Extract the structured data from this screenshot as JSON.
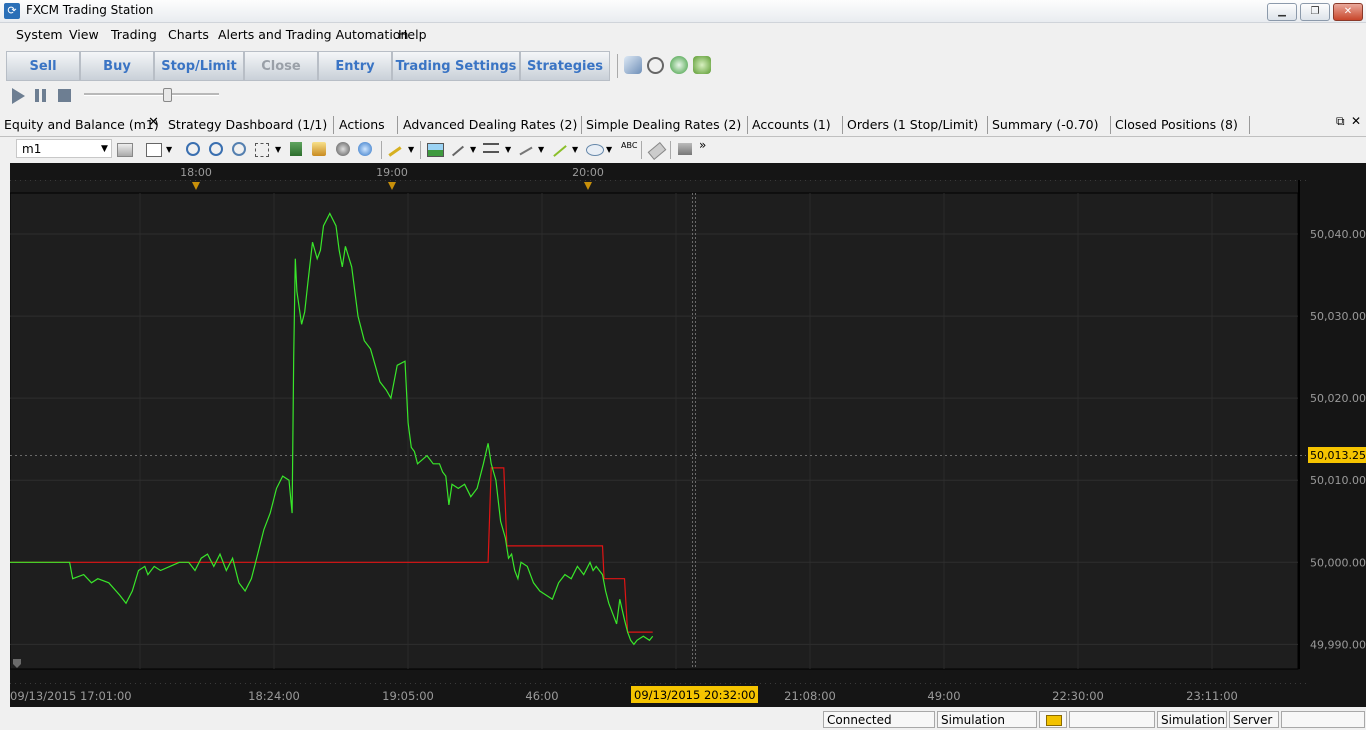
{
  "window": {
    "title": "FXCM Trading Station",
    "icon": "fxcm-logo-icon"
  },
  "menu": [
    "System",
    "View",
    "Trading",
    "Charts",
    "Alerts and Trading Automation",
    "Help"
  ],
  "toolbar": {
    "buttons": [
      "Sell",
      "Buy",
      "Stop/Limit",
      "Close",
      "Entry",
      "Trading Settings",
      "Strategies"
    ],
    "disabled": [
      "Close"
    ]
  },
  "tabs": [
    "Equity and Balance (m1)",
    "Strategy Dashboard (1/1)",
    "Actions",
    "Advanced Dealing Rates (2)",
    "Simple Dealing Rates (2)",
    "Accounts (1)",
    "Orders (1 Stop/Limit)",
    "Summary (-0.70)",
    "Closed Positions (8)"
  ],
  "chart_toolbar": {
    "timeframe": "m1"
  },
  "chart_data": {
    "type": "line",
    "top_axis_labels": [
      "18:00",
      "19:00",
      "20:00"
    ],
    "bottom_axis_labels": [
      "09/13/2015 17:01:00",
      "18:24:00",
      "19:05:00",
      "46:00",
      "21:08:00",
      "49:00",
      "22:30:00",
      "23:11:00"
    ],
    "cursor_time_label": "09/13/2015 20:32:00",
    "y_labels": [
      "50,040.00",
      "50,030.00",
      "50,020.00",
      "50,010.00",
      "50,000.00",
      "49,990.00"
    ],
    "ylim": [
      49987,
      50045
    ],
    "current_value_label": "50,013.25",
    "current_value": 50013.25,
    "colors": {
      "equity": "#39e62a",
      "balance": "#e01414",
      "highlight": "#f5c400",
      "background": "#1e1e1e"
    },
    "series": [
      {
        "values": [
          [
            0,
            50000
          ],
          [
            38,
            50000
          ],
          [
            40,
            49998
          ],
          [
            47,
            49998.5
          ],
          [
            52,
            49997.5
          ],
          [
            56,
            49998
          ],
          [
            63,
            49997.5
          ],
          [
            70,
            49996
          ],
          [
            74,
            49995
          ],
          [
            78,
            49996.5
          ],
          [
            82,
            49999
          ],
          [
            86,
            49999.5
          ],
          [
            88,
            49998.5
          ],
          [
            92,
            49999.5
          ],
          [
            96,
            49999
          ],
          [
            102,
            49999.5
          ],
          [
            108,
            50000
          ],
          [
            114,
            50000
          ],
          [
            118,
            49999
          ],
          [
            122,
            50000.5
          ],
          [
            126,
            50001
          ],
          [
            130,
            49999.5
          ],
          [
            134,
            50001
          ],
          [
            138,
            49999
          ],
          [
            142,
            50000.5
          ],
          [
            146,
            49997.5
          ],
          [
            150,
            49996.5
          ],
          [
            154,
            49998
          ],
          [
            158,
            50001
          ],
          [
            162,
            50004
          ],
          [
            166,
            50006
          ],
          [
            170,
            50009
          ],
          [
            174,
            50010.5
          ],
          [
            178,
            50010
          ],
          [
            180,
            50006
          ],
          [
            181,
            50025
          ],
          [
            182,
            50037
          ],
          [
            183,
            50033
          ],
          [
            186,
            50029
          ],
          [
            188,
            50030.5
          ],
          [
            190,
            50034
          ],
          [
            193,
            50039
          ],
          [
            196,
            50037
          ],
          [
            198,
            50038
          ],
          [
            200,
            50041
          ],
          [
            204,
            50042.5
          ],
          [
            208,
            50041
          ],
          [
            210,
            50038
          ],
          [
            212,
            50036
          ],
          [
            214,
            50038.5
          ],
          [
            218,
            50036
          ],
          [
            222,
            50030
          ],
          [
            226,
            50027
          ],
          [
            230,
            50026
          ],
          [
            233,
            50024
          ],
          [
            236,
            50022
          ],
          [
            240,
            50021
          ],
          [
            243,
            50020
          ],
          [
            247,
            50024
          ],
          [
            252,
            50024.5
          ],
          [
            254,
            50017
          ],
          [
            256,
            50014
          ],
          [
            258,
            50013.5
          ],
          [
            260,
            50012
          ],
          [
            263,
            50012.5
          ],
          [
            266,
            50013
          ],
          [
            270,
            50012
          ],
          [
            274,
            50012
          ],
          [
            276,
            50011
          ],
          [
            278,
            50010.5
          ],
          [
            280,
            50007
          ],
          [
            282,
            50009.5
          ],
          [
            286,
            50009
          ],
          [
            290,
            50009.5
          ],
          [
            294,
            50008
          ],
          [
            298,
            50009
          ],
          [
            302,
            50012
          ],
          [
            305,
            50014.5
          ],
          [
            307,
            50012
          ],
          [
            310,
            50010
          ],
          [
            313,
            50005
          ],
          [
            316,
            50003
          ],
          [
            318,
            50000.5
          ],
          [
            320,
            50001
          ],
          [
            322,
            49999
          ],
          [
            324,
            49998
          ],
          [
            326,
            50000
          ],
          [
            330,
            49999.5
          ],
          [
            334,
            49997.5
          ],
          [
            338,
            49996.5
          ],
          [
            342,
            49996
          ],
          [
            346,
            49995.5
          ],
          [
            350,
            49997.5
          ],
          [
            354,
            49998.5
          ],
          [
            358,
            49998
          ],
          [
            362,
            49999.5
          ],
          [
            366,
            49998.5
          ],
          [
            370,
            50000
          ],
          [
            372,
            49999
          ],
          [
            374,
            49999.5
          ],
          [
            378,
            49998.5
          ],
          [
            380,
            49996.5
          ],
          [
            382,
            49995
          ],
          [
            385,
            49993.5
          ],
          [
            387,
            49992.5
          ],
          [
            389,
            49995.5
          ],
          [
            392,
            49993
          ],
          [
            394,
            49991.5
          ],
          [
            396,
            49990.5
          ],
          [
            398,
            49990
          ],
          [
            400,
            49990.5
          ],
          [
            404,
            49991
          ],
          [
            408,
            49990.5
          ],
          [
            410,
            49991
          ]
        ]
      },
      {
        "values": [
          [
            0,
            50000
          ],
          [
            305,
            50000
          ],
          [
            307,
            50011.5
          ],
          [
            315,
            50011.5
          ],
          [
            317,
            50002
          ],
          [
            378,
            50002
          ],
          [
            379,
            49998
          ],
          [
            392,
            49998
          ],
          [
            394,
            49991.5
          ],
          [
            410,
            49991.5
          ]
        ]
      }
    ],
    "grid": true
  },
  "statusbar": {
    "connection": "Connected",
    "mode": "Simulation",
    "icon": "connection-plug-icon",
    "server_type": "Simulation",
    "server_label": "Server"
  }
}
